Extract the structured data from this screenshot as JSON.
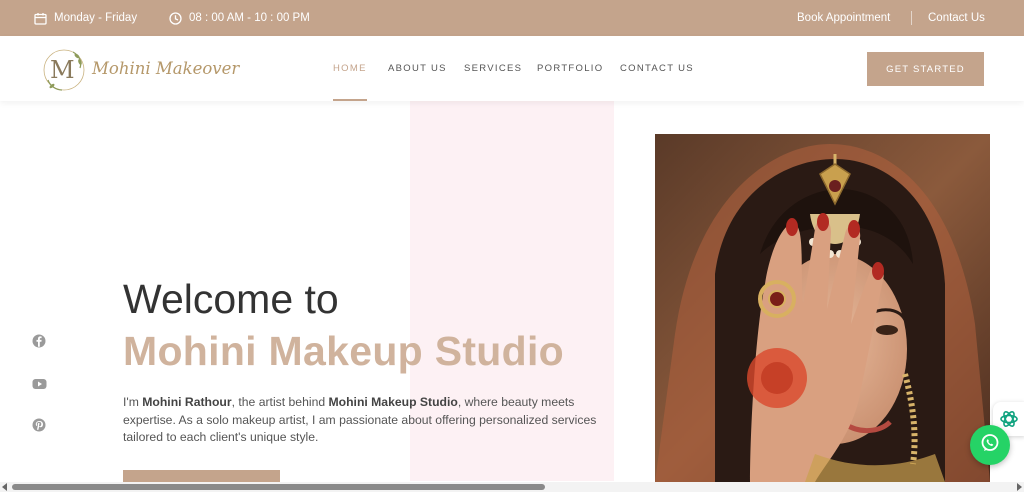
{
  "topbar": {
    "days": "Monday - Friday",
    "hours": "08 : 00 AM - 10 : 00 PM",
    "book": "Book Appointment",
    "contact": "Contact Us",
    "icons": [
      "calendar-icon",
      "clock-icon"
    ]
  },
  "brand": {
    "monogram": "M",
    "name": "Mohini Makeover"
  },
  "nav": {
    "items": [
      {
        "label": "HOME",
        "active": true
      },
      {
        "label": "ABOUT US",
        "active": false
      },
      {
        "label": "SERVICES",
        "active": false
      },
      {
        "label": "PORTFOLIO",
        "active": false
      },
      {
        "label": "CONTACT US",
        "active": false
      }
    ],
    "cta": "GET STARTED"
  },
  "hero": {
    "line1": "Welcome to",
    "line2": "Mohini Makeup Studio",
    "intro_prefix": "I'm ",
    "name": "Mohini Rathour",
    "intro_mid": ", the artist behind ",
    "studio": "Mohini Makeup Studio",
    "intro_rest": ", where beauty meets expertise. As a solo makeup artist, I am passionate about offering personalized services tailored to each client's unique style."
  },
  "socials": [
    "facebook-icon",
    "youtube-icon",
    "pinterest-icon"
  ],
  "colors": {
    "accent": "#c4a48c",
    "heading_accent": "#d0b39d",
    "whatsapp": "#25d366"
  }
}
